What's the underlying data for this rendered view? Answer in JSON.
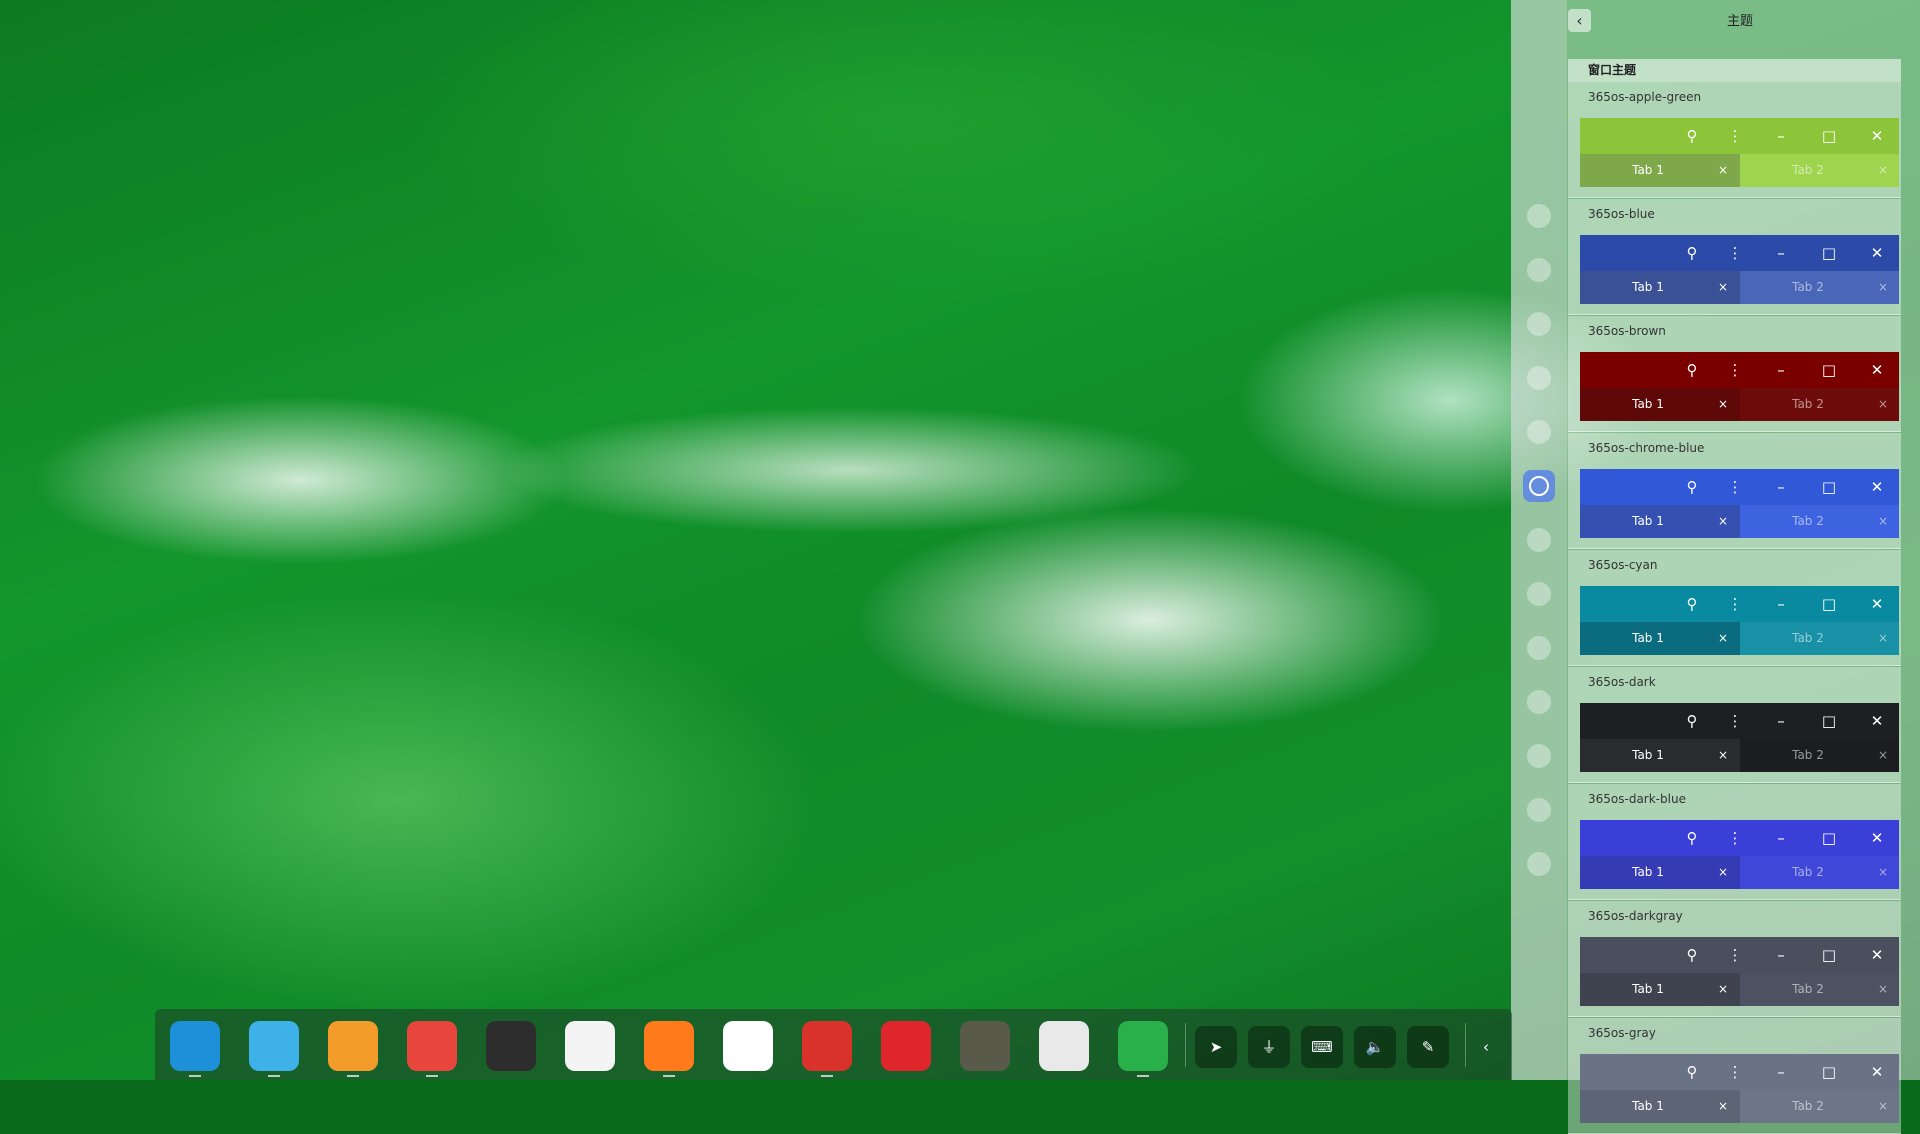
{
  "panel": {
    "title": "主题",
    "back_icon": "chevron-left-icon",
    "section_header": "窗口主题"
  },
  "themes": [
    {
      "name": "365os-apple-green",
      "title_color": "#8cc43a",
      "tab_active": "#7fa84a",
      "tab_inactive": "#9fd44f"
    },
    {
      "name": "365os-blue",
      "title_color": "#2c4aa8",
      "tab_active": "#3a5196",
      "tab_inactive": "#4a66b8"
    },
    {
      "name": "365os-brown",
      "title_color": "#7a0000",
      "tab_active": "#5e0808",
      "tab_inactive": "#6e0c0c"
    },
    {
      "name": "365os-chrome-blue",
      "title_color": "#3158d6",
      "tab_active": "#3550b0",
      "tab_inactive": "#3d63e0"
    },
    {
      "name": "365os-cyan",
      "title_color": "#0a8aa0",
      "tab_active": "#0b6c80",
      "tab_inactive": "#1890a6"
    },
    {
      "name": "365os-dark",
      "title_color": "#1e1f22",
      "tab_active": "#2a2b2f",
      "tab_inactive": "#1c1d20"
    },
    {
      "name": "365os-dark-blue",
      "title_color": "#3a3fd8",
      "tab_active": "#353ab5",
      "tab_inactive": "#4047d8"
    },
    {
      "name": "365os-darkgray",
      "title_color": "#4a4f5e",
      "tab_active": "#3f4350",
      "tab_inactive": "#4d5262"
    },
    {
      "name": "365os-gray",
      "title_color": "#6a7386",
      "tab_active": "#5c6476",
      "tab_inactive": "#6d7689"
    }
  ],
  "preview": {
    "tab1_label": "Tab 1",
    "tab2_label": "Tab 2",
    "close_glyph": "×",
    "icons": [
      "search-icon",
      "menu-dots-icon",
      "minimize-icon",
      "maximize-icon",
      "close-icon"
    ]
  },
  "rail_icons": [
    "account-icon",
    "cloud-icon",
    "display-icon",
    "default-apps-icon",
    "personalization-icon",
    "network-icon",
    "sound-icon",
    "time-icon",
    "power-icon",
    "mouse-icon",
    "keyboard-icon",
    "update-icon",
    "info-icon"
  ],
  "dock": {
    "apps": [
      {
        "name": "launcher-icon",
        "color": "#1e8fd9"
      },
      {
        "name": "file-manager-icon",
        "color": "#3db1e8"
      },
      {
        "name": "app-store-icon",
        "color": "#f39b2b"
      },
      {
        "name": "chrome-icon",
        "color": "#e8453c"
      },
      {
        "name": "color-picker-icon",
        "color": "#2d2d2d"
      },
      {
        "name": "calculator-icon",
        "color": "#f4f4f4"
      },
      {
        "name": "firefox-icon",
        "color": "#ff7a1a"
      },
      {
        "name": "text-editor-icon",
        "color": "#ffffff"
      },
      {
        "name": "terminal-icon",
        "color": "#d9322b"
      },
      {
        "name": "netease-music-icon",
        "color": "#e0262d"
      },
      {
        "name": "gimp-icon",
        "color": "#5a5a4a"
      },
      {
        "name": "settings-icon",
        "color": "#e9e9e9"
      },
      {
        "name": "telegram-icon",
        "color": "#29b04a"
      }
    ],
    "tray": [
      "telegram-tray-icon",
      "usb-icon",
      "keyboard-icon",
      "volume-icon",
      "pen-icon"
    ],
    "collapse_icon": "chevron-left-icon"
  }
}
